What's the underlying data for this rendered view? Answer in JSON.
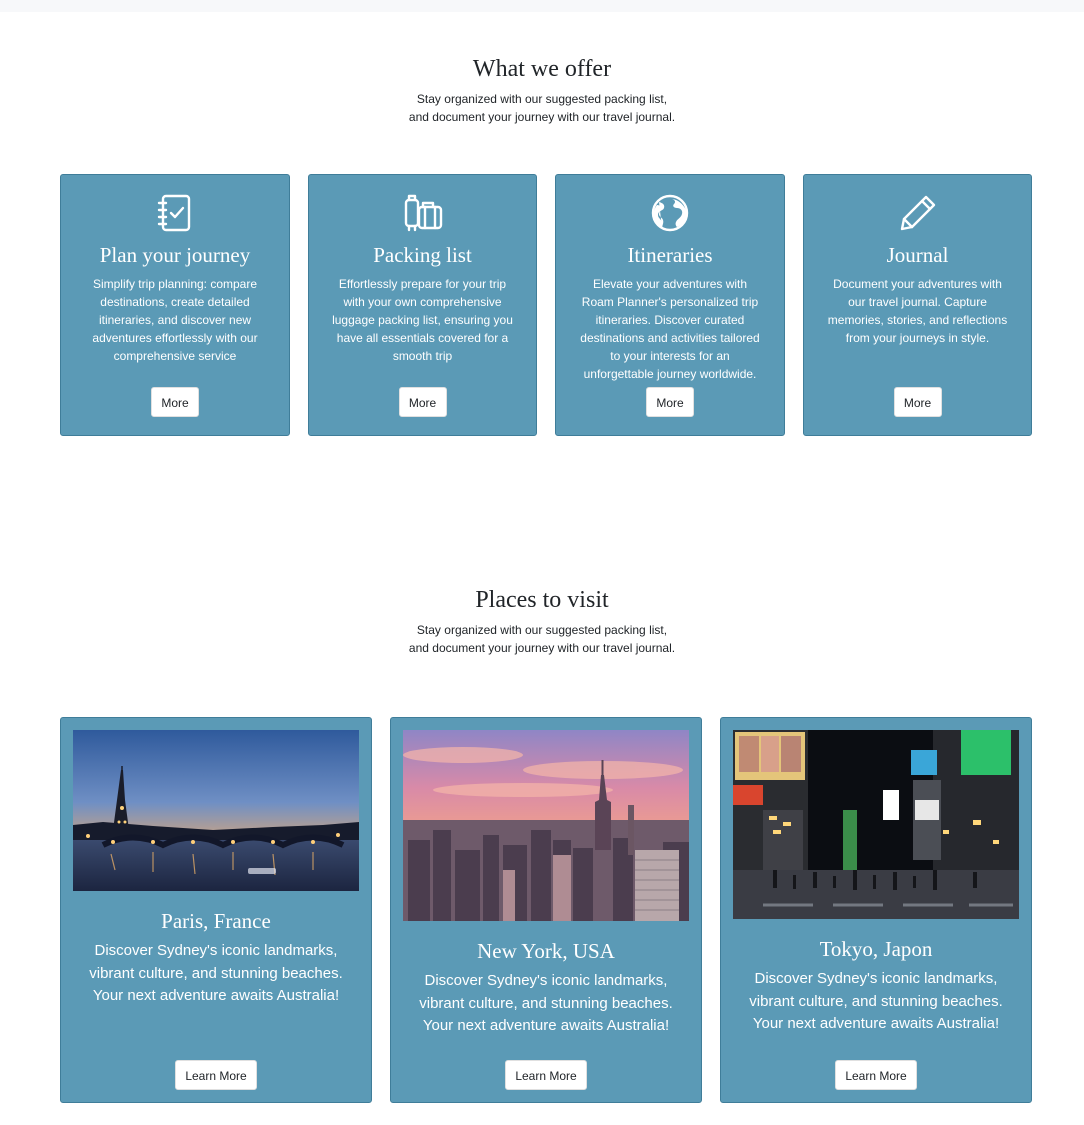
{
  "offer": {
    "title": "What we offer",
    "subtitle_line1": "Stay organized with our suggested packing list,",
    "subtitle_line2": "and document your journey with our travel journal.",
    "cards": [
      {
        "icon": "checklist-icon",
        "title": "Plan your journey",
        "description": "Simplify trip planning: compare destinations, create detailed itineraries, and discover new adventures effortlessly with our comprehensive service",
        "button": "More"
      },
      {
        "icon": "luggage-icon",
        "title": "Packing list",
        "description": "Effortlessly prepare for your trip with your own comprehensive luggage packing list, ensuring you have all essentials covered for a smooth trip",
        "button": "More"
      },
      {
        "icon": "globe-icon",
        "title": "Itineraries",
        "description": "Elevate your adventures with Roam Planner's personalized trip itineraries. Discover curated destinations and activities tailored to your interests for an unforgettable journey worldwide.",
        "button": "More"
      },
      {
        "icon": "pencil-icon",
        "title": "Journal",
        "description": "Document your adventures with our travel journal. Capture memories, stories, and reflections from your journeys in style.",
        "button": "More"
      }
    ]
  },
  "places": {
    "title": "Places to visit",
    "subtitle_line1": "Stay organized with our suggested packing list,",
    "subtitle_line2": "and document your journey with our travel journal.",
    "cards": [
      {
        "image": "paris-eiffel-tower-photo",
        "title": "Paris, France",
        "description": "Discover Sydney's iconic landmarks, vibrant culture, and stunning beaches. Your next adventure awaits Australia!",
        "button": "Learn More"
      },
      {
        "image": "new-york-skyline-photo",
        "title": "New York, USA",
        "description": "Discover Sydney's iconic landmarks, vibrant culture, and stunning beaches. Your next adventure awaits Australia!",
        "button": "Learn More"
      },
      {
        "image": "tokyo-shibuya-crossing-photo",
        "title": "Tokyo, Japon",
        "description": "Discover Sydney's iconic landmarks, vibrant culture, and stunning beaches. Your next adventure awaits Australia!",
        "button": "Learn More"
      }
    ]
  },
  "colors": {
    "card_background": "#5b9ab6",
    "card_border": "#3f7d99",
    "button_background": "#ffffff"
  }
}
